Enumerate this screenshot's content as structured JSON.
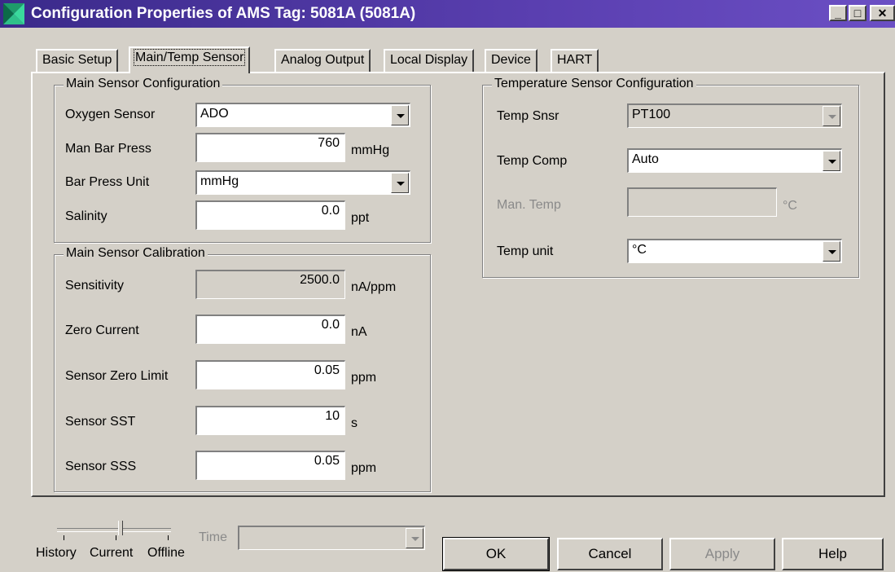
{
  "window": {
    "title": "Configuration Properties of AMS Tag: 5081A (5081A)",
    "caption_buttons": [
      "minimize",
      "maximize",
      "close"
    ]
  },
  "tabs": [
    {
      "label": "Basic Setup",
      "active": false
    },
    {
      "label": "Main/Temp Sensor",
      "active": true
    },
    {
      "label": "Analog Output",
      "active": false
    },
    {
      "label": "Local Display",
      "active": false
    },
    {
      "label": "Device",
      "active": false
    },
    {
      "label": "HART",
      "active": false
    }
  ],
  "main_config": {
    "legend": "Main Sensor Configuration",
    "oxygen_sensor": {
      "label": "Oxygen Sensor",
      "value": "ADO"
    },
    "man_bar_press": {
      "label": "Man Bar Press",
      "value": "760",
      "unit": "mmHg"
    },
    "bar_press_unit": {
      "label": "Bar Press Unit",
      "value": "mmHg"
    },
    "salinity": {
      "label": "Salinity",
      "value": "0.0",
      "unit": "ppt"
    }
  },
  "main_calib": {
    "legend": "Main Sensor Calibration",
    "sensitivity": {
      "label": "Sensitivity",
      "value": "2500.0",
      "unit": "nA/ppm"
    },
    "zero_current": {
      "label": "Zero Current",
      "value": "0.0",
      "unit": "nA"
    },
    "sensor_zero_limit": {
      "label": "Sensor Zero Limit",
      "value": "0.05",
      "unit": "ppm"
    },
    "sensor_sst": {
      "label": "Sensor SST",
      "value": "10",
      "unit": "s"
    },
    "sensor_sss": {
      "label": "Sensor SSS",
      "value": "0.05",
      "unit": "ppm"
    }
  },
  "temp_config": {
    "legend": "Temperature Sensor Configuration",
    "temp_snsr": {
      "label": "Temp Snsr",
      "value": "PT100"
    },
    "temp_comp": {
      "label": "Temp Comp",
      "value": "Auto"
    },
    "man_temp": {
      "label": "Man. Temp",
      "value": "",
      "unit": "°C"
    },
    "temp_unit": {
      "label": "Temp unit",
      "value": "°C"
    }
  },
  "footer": {
    "slider_labels": [
      "History",
      "Current",
      "Offline"
    ],
    "time_label": "Time",
    "time_value": "",
    "buttons": {
      "ok": "OK",
      "cancel": "Cancel",
      "apply": "Apply",
      "help": "Help"
    }
  }
}
